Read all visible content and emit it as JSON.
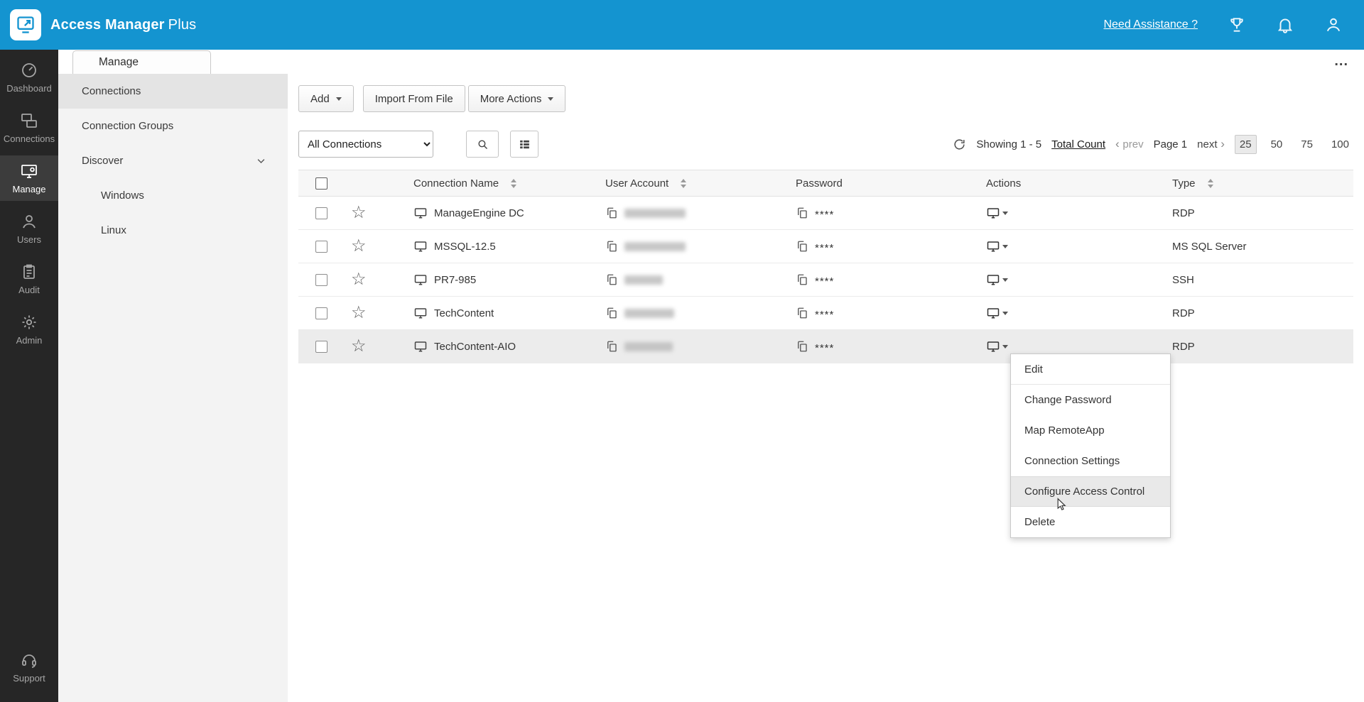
{
  "topbar": {
    "app_name": "Access Manager",
    "app_suffix": "Plus",
    "assist_link": "Need Assistance ?"
  },
  "colors": {
    "topbar": "#1494d0",
    "sidebar": "#262626",
    "selected_row": "#ececec"
  },
  "icons": {
    "star": "☆"
  },
  "sidebar": {
    "items": [
      {
        "label": "Dashboard"
      },
      {
        "label": "Connections"
      },
      {
        "label": "Manage"
      },
      {
        "label": "Users"
      },
      {
        "label": "Audit"
      },
      {
        "label": "Admin"
      }
    ],
    "active_item": "Manage",
    "support_label": "Support"
  },
  "subnav": {
    "tab_label": "Manage",
    "items": [
      {
        "label": "Connections"
      },
      {
        "label": "Connection Groups"
      },
      {
        "label": "Discover"
      },
      {
        "label": "Windows"
      },
      {
        "label": "Linux"
      }
    ],
    "selected_item": "Connections"
  },
  "toolbar": {
    "add_label": "Add",
    "import_label": "Import From File",
    "more_actions_label": "More Actions",
    "overflow_label": "..."
  },
  "filters": {
    "connection_filter_value": "All Connections",
    "showing_text": "Showing 1 - 5",
    "total_count_link": "Total Count",
    "prev_label": "prev",
    "page_label": "Page 1",
    "next_label": "next",
    "page_sizes": [
      "25",
      "50",
      "75",
      "100"
    ],
    "active_page_size": "25"
  },
  "table": {
    "headers": [
      "Connection Name",
      "User Account",
      "Password",
      "Actions",
      "Type"
    ],
    "rows": [
      {
        "name": "ManageEngine DC",
        "user_account_hidden": true,
        "password": "****",
        "type": "RDP"
      },
      {
        "name": "MSSQL-12.5",
        "user_account_hidden": true,
        "password": "****",
        "type": "MS SQL Server"
      },
      {
        "name": "PR7-985",
        "user_account_hidden": true,
        "password": "****",
        "type": "SSH"
      },
      {
        "name": "TechContent",
        "user_account_hidden": true,
        "password": "****",
        "type": "RDP"
      },
      {
        "name": "TechContent-AIO",
        "user_account_hidden": true,
        "password": "****",
        "type": "RDP"
      }
    ],
    "selected_row": "TechContent-AIO"
  },
  "context_menu": {
    "items": [
      "Edit",
      "Change Password",
      "Map RemoteApp",
      "Connection Settings",
      "Configure Access Control",
      "Delete"
    ],
    "highlighted_item": "Configure Access Control"
  }
}
